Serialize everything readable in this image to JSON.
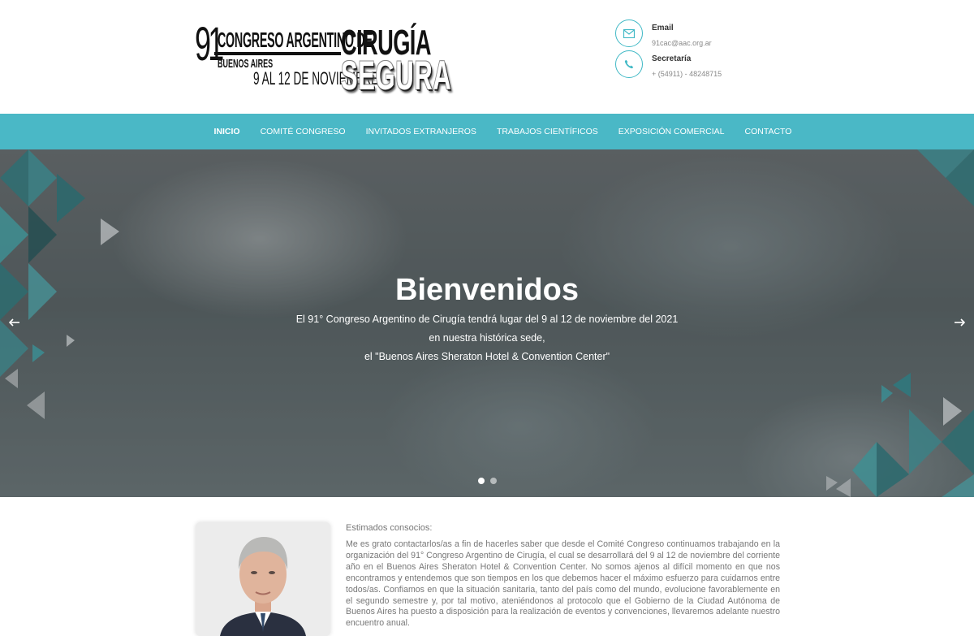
{
  "logo": {
    "number": "91",
    "line1": "CONGRESO ARGENTINO DE",
    "line1b": "CIRUGÍA",
    "line2": "BUENOS AIRES",
    "line3": "9 AL 12 DE NOVIEMBRE",
    "line4": "SEGURA"
  },
  "contact": {
    "email_label": "Email",
    "email_value": "91cac@aac.org.ar",
    "phone_label": "Secretaría",
    "phone_value": "+ (54911) - 48248715",
    "icon_color": "#3fb8c5"
  },
  "nav": {
    "items": [
      {
        "label": "INICIO"
      },
      {
        "label": "COMITÉ CONGRESO"
      },
      {
        "label": "INVITADOS EXTRANJEROS"
      },
      {
        "label": "TRABAJOS CIENTÍFICOS"
      },
      {
        "label": "EXPOSICIÓN COMERCIAL"
      },
      {
        "label": "CONTACTO"
      }
    ],
    "bg_color": "#4ab8c6"
  },
  "hero": {
    "title": "Bienvenidos",
    "line1": "El 91° Congreso Argentino de Cirugía tendrá lugar del 9 al 12 de noviembre del 2021",
    "line2": "en nuestra histórica sede,",
    "line3": "el \"Buenos Aires Sheraton Hotel & Convention Center\"",
    "slides": 2,
    "active_slide": 1
  },
  "content": {
    "greeting": "Estimados consocios:",
    "paragraph": "Me es grato contactarlos/as a fin de hacerles saber que desde el Comité Congreso continuamos trabajando en la organización del 91° Congreso Argentino de Cirugía, el cual se desarrollará del 9 al 12 de noviembre del corriente año en el Buenos Aires Sheraton Hotel & Convention Center. No somos ajenos al difícil momento en que nos encontramos y entendemos que son tiempos en los que debemos hacer el máximo esfuerzo para cuidarnos entre todos/as. Confiamos en que la situación sanitaria, tanto del país como del mundo, evolucione favorablemente en el segundo semestre y, por tal motivo, ateniéndonos al protocolo que el Gobierno de la Ciudad Autónoma de Buenos Aires ha puesto a disposición para la realización de eventos y convenciones, llevaremos adelante nuestro encuentro anual."
  }
}
